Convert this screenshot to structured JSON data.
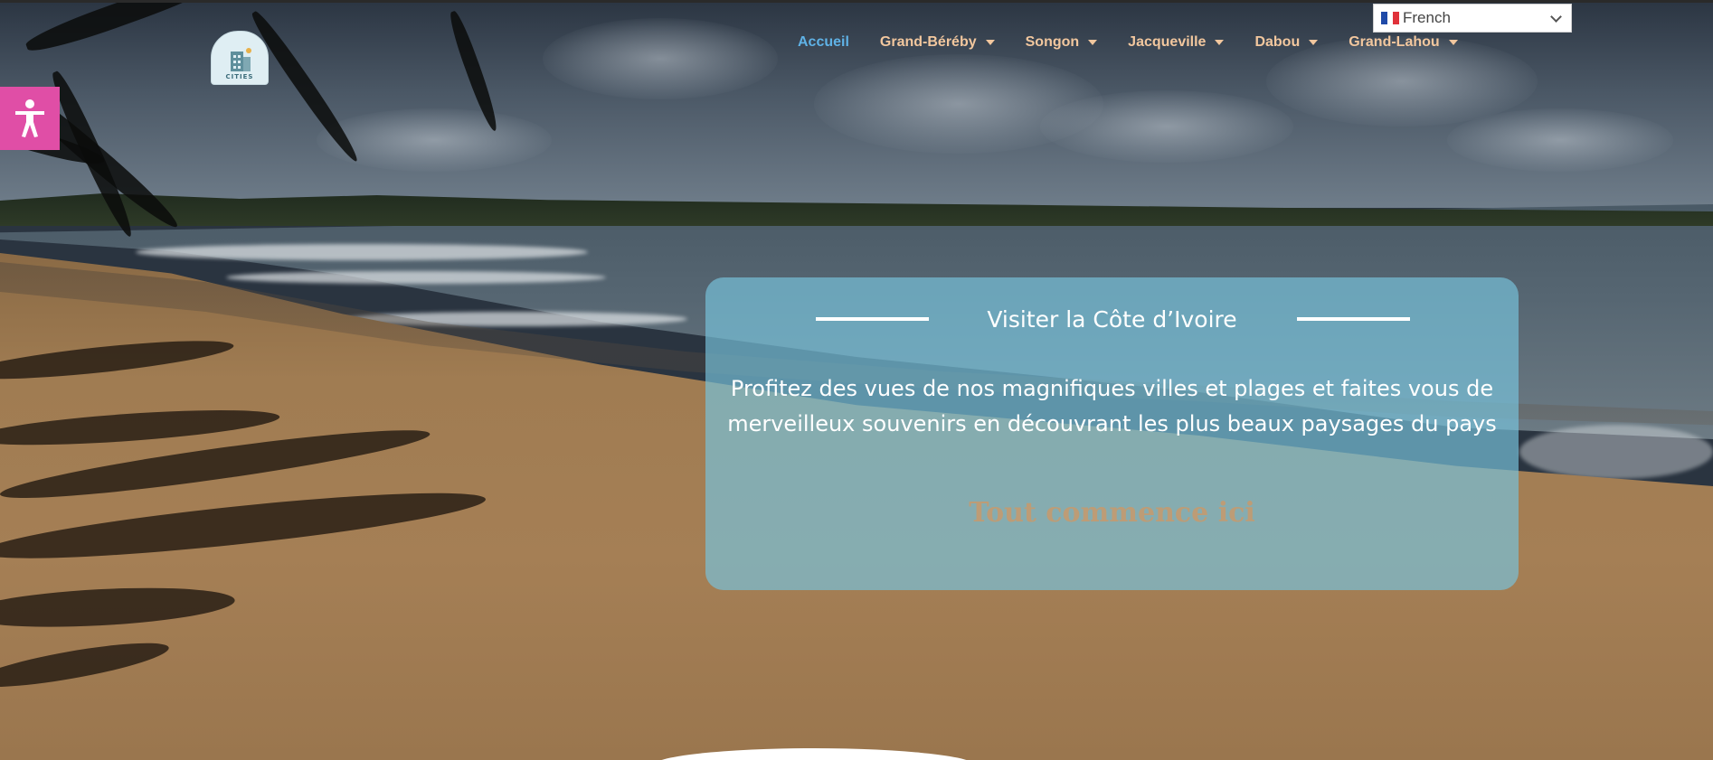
{
  "logo": {
    "text": "CITIES"
  },
  "nav": {
    "items": [
      {
        "label": "Accueil",
        "active": true,
        "dropdown": false
      },
      {
        "label": "Grand-Béréby",
        "active": false,
        "dropdown": true
      },
      {
        "label": "Songon",
        "active": false,
        "dropdown": true
      },
      {
        "label": "Jacqueville",
        "active": false,
        "dropdown": true
      },
      {
        "label": "Dabou",
        "active": false,
        "dropdown": true
      },
      {
        "label": "Grand-Lahou",
        "active": false,
        "dropdown": true
      }
    ]
  },
  "language": {
    "selected": "French",
    "icon": "chevron-down-icon"
  },
  "accessibility": {
    "icon": "accessibility-person-icon",
    "color": "#e04ea6"
  },
  "hero": {
    "title": "Visiter la Côte d’Ivoire",
    "body": "Profitez des vues de nos magnifiques villes et plages et faites vous de merveilleux souvenirs en découvrant les plus beaux paysages du pays",
    "cta": "Tout commence ici"
  },
  "colors": {
    "nav_text": "#f2c79e",
    "nav_active": "#5fb2e6",
    "card_bg": "rgba(120,195,220,0.68)",
    "cta_text": "#c79a6d"
  }
}
